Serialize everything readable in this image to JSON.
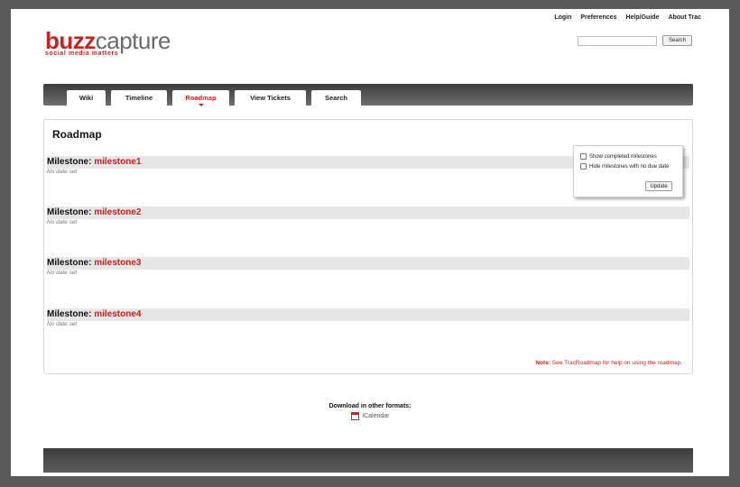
{
  "metanav": [
    "Login",
    "Preferences",
    "Help/Guide",
    "About Trac"
  ],
  "logo": {
    "part1": "buzz",
    "part2": "capture",
    "tagline": "social media matters"
  },
  "search": {
    "value": "",
    "button": "Search"
  },
  "tabs": [
    {
      "label": "Wiki",
      "active": false
    },
    {
      "label": "Timeline",
      "active": false
    },
    {
      "label": "Roadmap",
      "active": true
    },
    {
      "label": "View Tickets",
      "active": false
    },
    {
      "label": "Search",
      "active": false
    }
  ],
  "page_title": "Roadmap",
  "milestone_prefix": "Milestone:",
  "milestones": [
    {
      "name": "milestone1",
      "date": "No date set"
    },
    {
      "name": "milestone2",
      "date": "No date set"
    },
    {
      "name": "milestone3",
      "date": "No date set"
    },
    {
      "name": "milestone4",
      "date": "No date set"
    }
  ],
  "options": {
    "show_completed": "Show completed milestones",
    "hide_no_due": "Hide milestones with no due date",
    "update": "Update"
  },
  "note": {
    "label": "Note:",
    "see": "See",
    "link": "TracRoadmap",
    "rest": "for help on using the roadmap."
  },
  "download": {
    "title": "Download in other formats:",
    "item": "iCalendar"
  },
  "colors": {
    "accent": "#c8231e",
    "nav_bar": "#4a4a4a",
    "milestone_bg": "#e6e6e6"
  }
}
